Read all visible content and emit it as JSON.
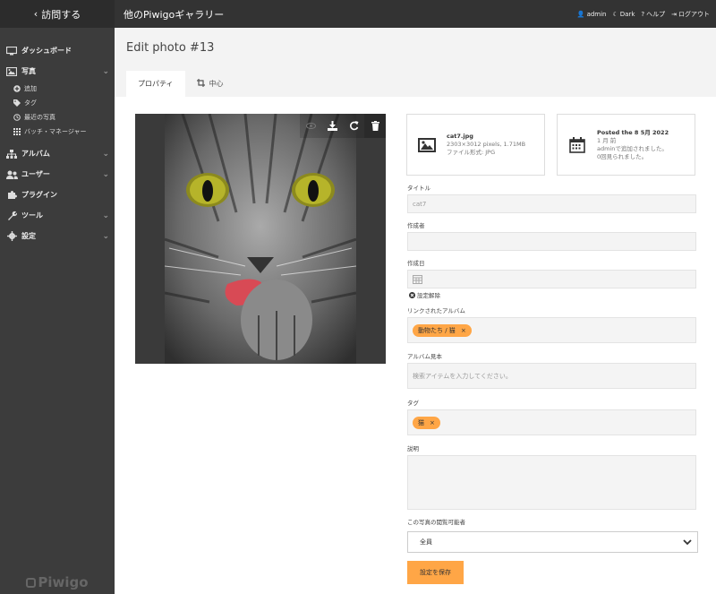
{
  "sidebar": {
    "back_label": "訪問する",
    "items": [
      {
        "label": "ダッシュボード",
        "icon": "monitor-icon"
      },
      {
        "label": "写真",
        "icon": "image-icon"
      },
      {
        "label": "アルバム",
        "icon": "sitemap-icon"
      },
      {
        "label": "ユーザー",
        "icon": "users-icon"
      },
      {
        "label": "プラグイン",
        "icon": "puzzle-icon"
      },
      {
        "label": "ツール",
        "icon": "wrench-icon"
      },
      {
        "label": "設定",
        "icon": "gear-icon"
      }
    ],
    "photo_subitems": [
      {
        "label": "追加",
        "icon": "plus-circle-icon"
      },
      {
        "label": "タグ",
        "icon": "tags-icon"
      },
      {
        "label": "最近の写真",
        "icon": "clock-icon"
      },
      {
        "label": "バッチ・マネージャー",
        "icon": "grid-icon"
      }
    ],
    "logo": "Piwigo"
  },
  "topbar": {
    "gallery_title": "他のPiwigoギャラリー",
    "user": "admin",
    "theme": "Dark",
    "help": "ヘルプ",
    "logout": "ログアウト"
  },
  "page": {
    "title": "Edit photo #13",
    "tabs": [
      {
        "label": "プロパティ",
        "active": true
      },
      {
        "label": "中心",
        "icon": "crop-icon",
        "active": false
      }
    ]
  },
  "file_card": {
    "filename": "cat7.jpg",
    "dimensions": "2303×3012 pixels, 1.71MB",
    "format": "ファイル形式: JPG"
  },
  "post_card": {
    "posted": "Posted the 8 5月 2022",
    "ago": "1 月 前",
    "added_by": "adminで追加されました。",
    "views": "0回見られました。"
  },
  "form": {
    "title_label": "タイトル",
    "title_value": "cat7",
    "author_label": "作成者",
    "author_value": "",
    "date_label": "作成日",
    "date_value": "",
    "clear_date": "設定解除",
    "albums_label": "リンクされたアルバム",
    "album_tags": [
      "動物たち / 猫"
    ],
    "representative_label": "アルバム見本",
    "representative_placeholder": "検索アイテムを入力してください。",
    "tags_label": "タグ",
    "tags": [
      "猫"
    ],
    "description_label": "説明",
    "description_value": "",
    "privacy_label": "この写真の閲覧可能者",
    "privacy_value": "全員",
    "save_label": "設定を保存"
  }
}
